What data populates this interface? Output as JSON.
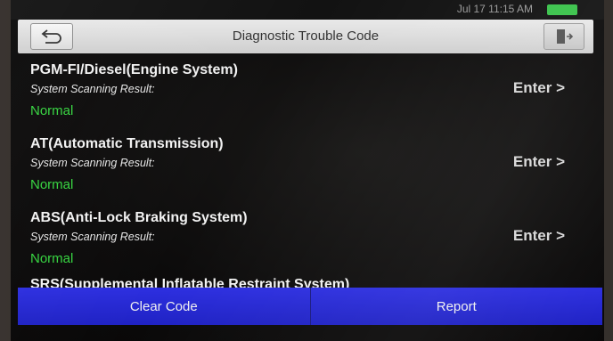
{
  "status_bar": {
    "time_text": "Jul 17   11:15 AM"
  },
  "header": {
    "title": "Diagnostic Trouble Code"
  },
  "icons": {
    "back": "back-arrow-icon",
    "exit": "exit-door-icon"
  },
  "systems": [
    {
      "name": "PGM-FI/Diesel(Engine System)",
      "result_label": "System Scanning Result:",
      "status": "Normal",
      "enter": "Enter >"
    },
    {
      "name": "AT(Automatic Transmission)",
      "result_label": "System Scanning Result:",
      "status": "Normal",
      "enter": "Enter >"
    },
    {
      "name": "ABS(Anti-Lock Braking System)",
      "result_label": "System Scanning Result:",
      "status": "Normal",
      "enter": "Enter >"
    },
    {
      "name": "SRS(Supplemental Inflatable Restraint System)"
    }
  ],
  "actions": {
    "clear_code": "Clear Code",
    "report": "Report"
  },
  "colors": {
    "status_normal": "#35d43f",
    "action_bar": "#2528d4"
  }
}
